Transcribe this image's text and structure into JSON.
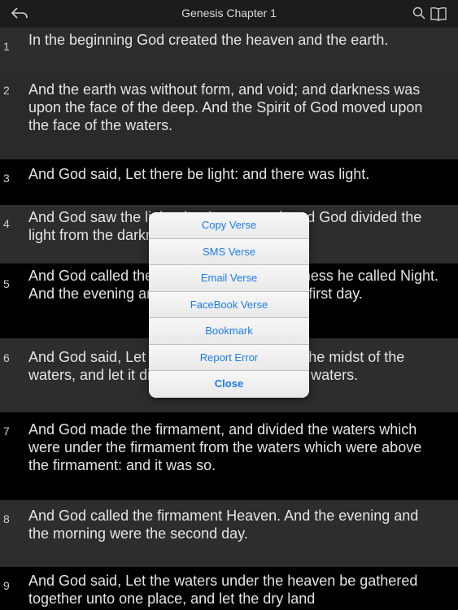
{
  "navbar": {
    "title": "Genesis Chapter 1",
    "back_icon": "back-arrow-icon",
    "search_icon": "search-icon",
    "book_icon": "book-icon"
  },
  "verses": [
    {
      "num": "1",
      "text": "In the beginning God created the heaven and the earth."
    },
    {
      "num": "2",
      "text": "And the earth was without form, and void; and darkness was upon the face of the deep. And the Spirit of God moved upon the face of the waters."
    },
    {
      "num": "3",
      "text": "And God said, Let there be light: and there was light."
    },
    {
      "num": "4",
      "text": "And God saw the light, that it was good: and God divided the light from the darkness."
    },
    {
      "num": "5",
      "text": "And God called the light Day, and the darkness he called Night. And the evening and the morning were the first day."
    },
    {
      "num": "6",
      "text": "And God said, Let there be a firmament in the midst of the waters, and let it divide the waters from the waters."
    },
    {
      "num": "7",
      "text": "And God made the firmament, and divided the waters which were under the firmament from the waters which were above the firmament: and it was so."
    },
    {
      "num": "8",
      "text": "And God called the firmament Heaven. And the evening and the morning were the second day."
    },
    {
      "num": "9",
      "text": "And God said, Let the waters under the heaven be gathered together unto one place, and let the dry land"
    }
  ],
  "menu": {
    "items": [
      "Copy Verse",
      "SMS Verse",
      "Email Verse",
      "FaceBook Verse",
      "Bookmark",
      "Report Error",
      "Close"
    ]
  },
  "colors": {
    "accent": "#1a7cf0",
    "row_odd": "#2d2d2f",
    "row_even": "#000000",
    "navbar": "#1c1c1e"
  }
}
